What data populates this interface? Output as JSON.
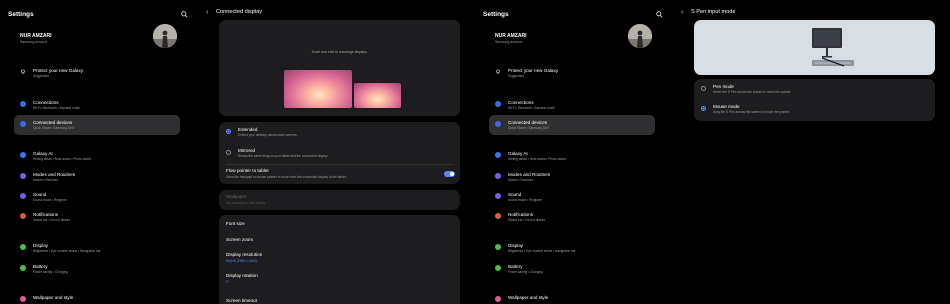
{
  "colors": {
    "background": "#000000",
    "card": "#1d1d1f",
    "selected_row": "#2f2f31",
    "accent": "#5b83ff"
  },
  "screens": [
    {
      "sidebar": {
        "title": "Settings",
        "profile": {
          "name": "NUR AMZARI",
          "subtitle": "Samsung account"
        },
        "suggestion": {
          "label": "Protect your new Galaxy",
          "sub": "Suggestion"
        },
        "items": [
          {
            "label": "Connections",
            "sub": "Wi-Fi  •  Bluetooth  •  Airplane mode",
            "icon": "wifi-icon",
            "color": "#3e6be8"
          },
          {
            "label": "Connected devices",
            "sub": "Quick Share  •  Samsung DeX",
            "icon": "devices-icon",
            "color": "#3e6be8"
          },
          {
            "label": "Galaxy AI",
            "sub": "Writing assist  •  Note assist  •  Photo assist",
            "icon": "ai-icon",
            "color": "#3d73f5"
          },
          {
            "label": "Modes and Routines",
            "sub": "Modes  •  Routines",
            "icon": "modes-icon",
            "color": "#7a5cf0"
          },
          {
            "label": "Sound",
            "sub": "Sound mode  •  Ringtone",
            "icon": "sound-icon",
            "color": "#7a5cf0"
          },
          {
            "label": "Notifications",
            "sub": "Status bar  •  Do not disturb",
            "icon": "bell-icon",
            "color": "#e0584a"
          },
          {
            "label": "Display",
            "sub": "Brightness  •  Eye comfort shield  •  Navigation bar",
            "icon": "display-icon",
            "color": "#4fbf45"
          },
          {
            "label": "Battery",
            "sub": "Power saving  •  Charging",
            "icon": "battery-icon",
            "color": "#4fbf45"
          },
          {
            "label": "Wallpaper and style",
            "sub": "",
            "icon": "palette-icon",
            "color": "#e35a93"
          }
        ]
      },
      "pane": {
        "title": "Connected display",
        "hint": "Touch and hold to rearrange displays.",
        "options": [
          {
            "label": "Extended",
            "sub": "Extend your desktop across both screens.",
            "selected": true
          },
          {
            "label": "Mirrored",
            "sub": "Shows the same thing on your tablet and the connected display.",
            "selected": false
          }
        ],
        "flow": {
          "label": "Flow pointer to tablet",
          "sub": "Allow the trackpad or mouse pointer to move from the connected display to the tablet.",
          "enabled": true
        },
        "wallpaper": {
          "label": "Wallpaper",
          "sub": "Not available on this display"
        },
        "settings": [
          {
            "label": "Font size",
            "sub": ""
          },
          {
            "label": "Screen zoom",
            "sub": ""
          },
          {
            "label": "Display resolution",
            "sub": "WQHD (2560 x 1440)"
          },
          {
            "label": "Display rotation",
            "sub": "0°"
          },
          {
            "label": "Screen timeout",
            "sub": ""
          }
        ]
      }
    },
    {
      "sidebar": {
        "title": "Settings",
        "profile": {
          "name": "NUR AMZARI",
          "subtitle": "Samsung account"
        },
        "suggestion": {
          "label": "Protect your new Galaxy",
          "sub": "Suggestion"
        },
        "items": [
          {
            "label": "Connections",
            "sub": "Wi-Fi  •  Bluetooth  •  Airplane mode",
            "icon": "wifi-icon",
            "color": "#3e6be8"
          },
          {
            "label": "Connected devices",
            "sub": "Quick Share  •  Samsung DeX",
            "icon": "devices-icon",
            "color": "#3e6be8"
          },
          {
            "label": "Galaxy AI",
            "sub": "Writing assist  •  Note assist  •  Photo assist",
            "icon": "ai-icon",
            "color": "#3d73f5"
          },
          {
            "label": "Modes and Routines",
            "sub": "Modes  •  Routines",
            "icon": "modes-icon",
            "color": "#7a5cf0"
          },
          {
            "label": "Sound",
            "sub": "Sound mode  •  Ringtone",
            "icon": "sound-icon",
            "color": "#7a5cf0"
          },
          {
            "label": "Notifications",
            "sub": "Status bar  •  Do not disturb",
            "icon": "bell-icon",
            "color": "#e0584a"
          },
          {
            "label": "Display",
            "sub": "Brightness  •  Eye comfort shield  •  Navigation bar",
            "icon": "display-icon",
            "color": "#4fbf45"
          },
          {
            "label": "Battery",
            "sub": "Power saving  •  Charging",
            "icon": "battery-icon",
            "color": "#4fbf45"
          },
          {
            "label": "Wallpaper and style",
            "sub": "",
            "icon": "palette-icon",
            "color": "#e35a93"
          }
        ]
      },
      "pane": {
        "title": "S Pen input mode",
        "options": [
          {
            "label": "Pen mode",
            "sub": "Hover the S Pen across the screen to move the pointer.",
            "selected": false
          },
          {
            "label": "Mouse mode",
            "sub": "Drag the S Pen across the screen to move the pointer.",
            "selected": true
          }
        ]
      }
    }
  ]
}
